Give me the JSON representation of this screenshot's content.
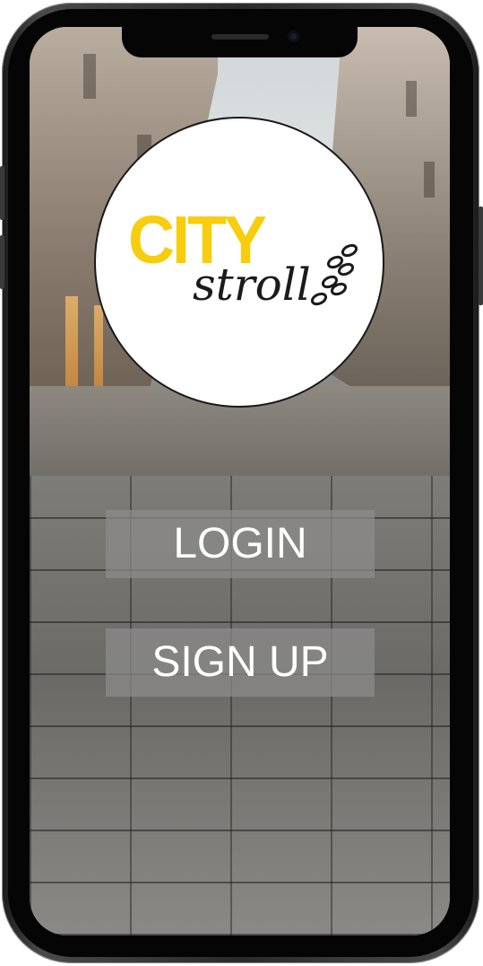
{
  "app": {
    "logo": {
      "word_primary": "CITY",
      "word_secondary": "stroll",
      "primary_color": "#f7cd0d",
      "icon": "footprints-icon"
    },
    "actions": {
      "login_label": "LOGIN",
      "signup_label": "SIGN UP"
    },
    "background": "city-street-photo"
  }
}
